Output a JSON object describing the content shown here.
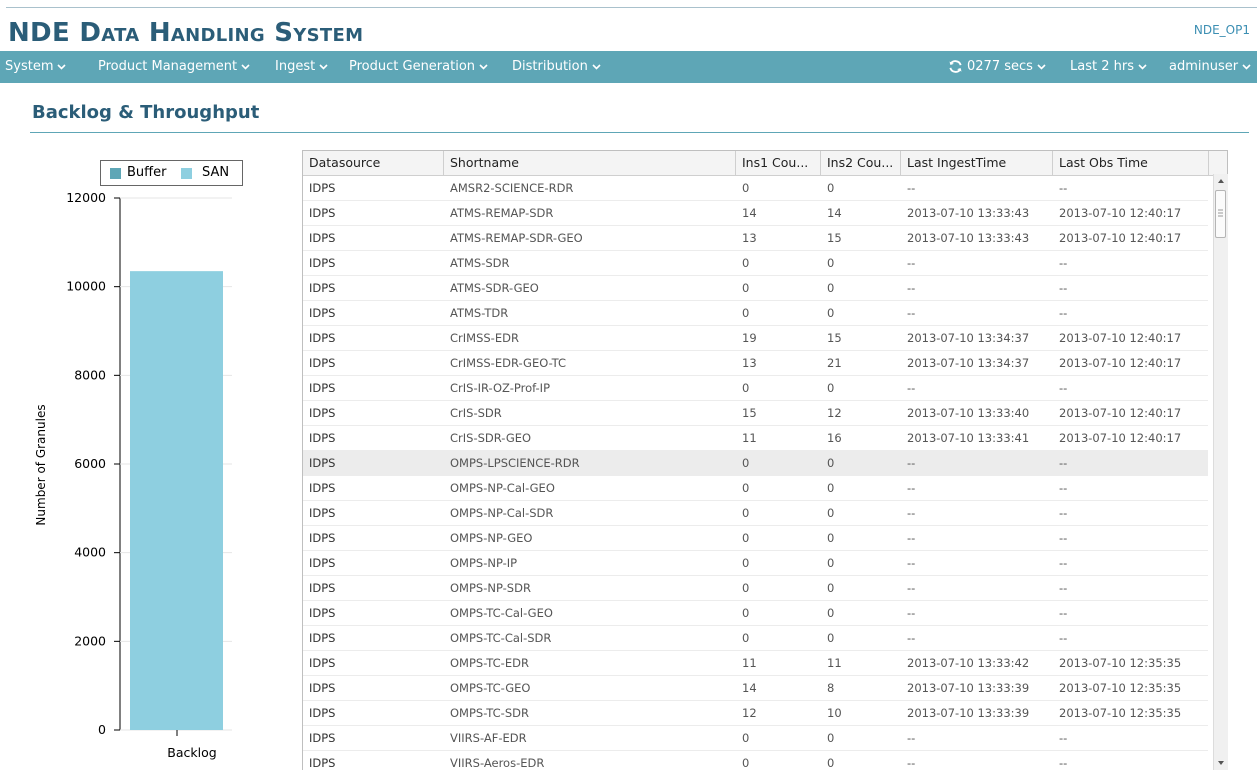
{
  "app": {
    "title": "NDE Data Handling System",
    "system_id": "NDE_OP1"
  },
  "nav": {
    "menus": [
      "System",
      "Product Management",
      "Ingest",
      "Product Generation",
      "Distribution"
    ],
    "refresh_label": "0277 secs",
    "time_range": "Last 2 hrs",
    "user": "adminuser"
  },
  "page": {
    "heading": "Backlog & Throughput"
  },
  "colors": {
    "accent": "#5ea6b6",
    "title": "#2b5d78",
    "buffer": "#5ea6b6",
    "san": "#8ecfe0"
  },
  "icons": {
    "refresh": "refresh-icon",
    "dropdown": "chevron-down-icon"
  },
  "chart_data": {
    "type": "bar",
    "categories": [
      "Backlog"
    ],
    "series": [
      {
        "name": "Buffer",
        "values": [
          0
        ],
        "color": "#5ea6b6"
      },
      {
        "name": "SAN",
        "values": [
          10350
        ],
        "color": "#8ecfe0"
      }
    ],
    "stacked": true,
    "xlabel": "",
    "ylabel": "Number of Granules",
    "ylim": [
      0,
      12000
    ],
    "yticks": [
      0,
      2000,
      4000,
      6000,
      8000,
      10000,
      12000
    ],
    "legend": "top",
    "grid": false
  },
  "table": {
    "columns": [
      "Datasource",
      "Shortname",
      "Ins1 Cou...",
      "Ins2 Cou...",
      "Last IngestTime",
      "Last Obs Time"
    ],
    "selected_row": 11,
    "rows": [
      [
        "IDPS",
        "AMSR2-SCIENCE-RDR",
        "0",
        "0",
        "--",
        "--"
      ],
      [
        "IDPS",
        "ATMS-REMAP-SDR",
        "14",
        "14",
        "2013-07-10 13:33:43",
        "2013-07-10 12:40:17"
      ],
      [
        "IDPS",
        "ATMS-REMAP-SDR-GEO",
        "13",
        "15",
        "2013-07-10 13:33:43",
        "2013-07-10 12:40:17"
      ],
      [
        "IDPS",
        "ATMS-SDR",
        "0",
        "0",
        "--",
        "--"
      ],
      [
        "IDPS",
        "ATMS-SDR-GEO",
        "0",
        "0",
        "--",
        "--"
      ],
      [
        "IDPS",
        "ATMS-TDR",
        "0",
        "0",
        "--",
        "--"
      ],
      [
        "IDPS",
        "CrIMSS-EDR",
        "19",
        "15",
        "2013-07-10 13:34:37",
        "2013-07-10 12:40:17"
      ],
      [
        "IDPS",
        "CrIMSS-EDR-GEO-TC",
        "13",
        "21",
        "2013-07-10 13:34:37",
        "2013-07-10 12:40:17"
      ],
      [
        "IDPS",
        "CrIS-IR-OZ-Prof-IP",
        "0",
        "0",
        "--",
        "--"
      ],
      [
        "IDPS",
        "CrIS-SDR",
        "15",
        "12",
        "2013-07-10 13:33:40",
        "2013-07-10 12:40:17"
      ],
      [
        "IDPS",
        "CrIS-SDR-GEO",
        "11",
        "16",
        "2013-07-10 13:33:41",
        "2013-07-10 12:40:17"
      ],
      [
        "IDPS",
        "OMPS-LPSCIENCE-RDR",
        "0",
        "0",
        "--",
        "--"
      ],
      [
        "IDPS",
        "OMPS-NP-Cal-GEO",
        "0",
        "0",
        "--",
        "--"
      ],
      [
        "IDPS",
        "OMPS-NP-Cal-SDR",
        "0",
        "0",
        "--",
        "--"
      ],
      [
        "IDPS",
        "OMPS-NP-GEO",
        "0",
        "0",
        "--",
        "--"
      ],
      [
        "IDPS",
        "OMPS-NP-IP",
        "0",
        "0",
        "--",
        "--"
      ],
      [
        "IDPS",
        "OMPS-NP-SDR",
        "0",
        "0",
        "--",
        "--"
      ],
      [
        "IDPS",
        "OMPS-TC-Cal-GEO",
        "0",
        "0",
        "--",
        "--"
      ],
      [
        "IDPS",
        "OMPS-TC-Cal-SDR",
        "0",
        "0",
        "--",
        "--"
      ],
      [
        "IDPS",
        "OMPS-TC-EDR",
        "11",
        "11",
        "2013-07-10 13:33:42",
        "2013-07-10 12:35:35"
      ],
      [
        "IDPS",
        "OMPS-TC-GEO",
        "14",
        "8",
        "2013-07-10 13:33:39",
        "2013-07-10 12:35:35"
      ],
      [
        "IDPS",
        "OMPS-TC-SDR",
        "12",
        "10",
        "2013-07-10 13:33:39",
        "2013-07-10 12:35:35"
      ],
      [
        "IDPS",
        "VIIRS-AF-EDR",
        "0",
        "0",
        "--",
        "--"
      ],
      [
        "IDPS",
        "VIIRS-Aeros-EDR",
        "0",
        "0",
        "--",
        "--"
      ]
    ]
  }
}
